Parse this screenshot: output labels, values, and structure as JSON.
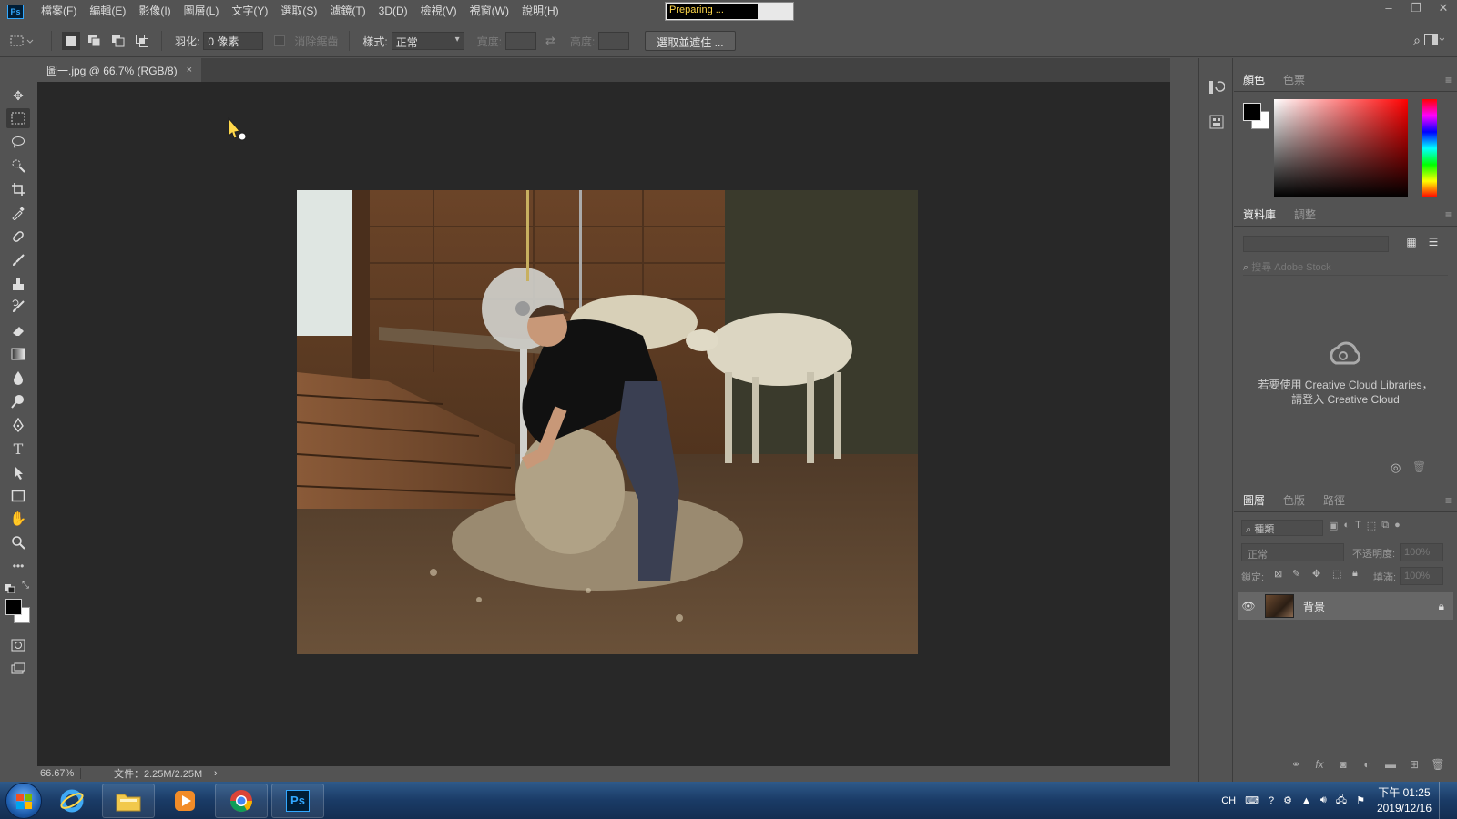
{
  "app": {
    "logo": "Ps",
    "progress_text": "Preparing ..."
  },
  "menu": [
    "檔案(F)",
    "編輯(E)",
    "影像(I)",
    "圖層(L)",
    "文字(Y)",
    "選取(S)",
    "濾鏡(T)",
    "3D(D)",
    "檢視(V)",
    "視窗(W)",
    "說明(H)"
  ],
  "window_controls": {
    "minimize": "–",
    "restore": "❐",
    "close": "✕"
  },
  "options": {
    "feather_label": "羽化:",
    "feather_value": "0 像素",
    "antialias_label": "消除鋸齒",
    "style_label": "樣式:",
    "style_value": "正常",
    "width_label": "寬度:",
    "height_label": "高度:",
    "select_mask_button": "選取並遮住 ..."
  },
  "document": {
    "tab_title": "圖一.jpg @ 66.7% (RGB/8)",
    "close": "×"
  },
  "status": {
    "zoom": "66.67%",
    "doc_info": "文件：2.25M/2.25M",
    "arrow": "›"
  },
  "panels": {
    "color": {
      "tabs": [
        "顏色",
        "色票"
      ]
    },
    "libraries": {
      "tabs": [
        "資料庫",
        "調整"
      ],
      "search_placeholder": "搜尋 Adobe Stock",
      "message_line1": "若要使用 Creative Cloud Libraries，",
      "message_line2": "請登入 Creative Cloud"
    },
    "layers": {
      "tabs": [
        "圖層",
        "色版",
        "路徑"
      ],
      "filter_label": "種類",
      "blend_mode": "正常",
      "opacity_label": "不透明度:",
      "opacity_value": "100%",
      "lock_label": "鎖定:",
      "fill_label": "填滿:",
      "fill_value": "100%",
      "layer_name": "背景"
    }
  },
  "taskbar": {
    "tray_lang": "CH",
    "clock_time": "下午 01:25",
    "clock_date": "2019/12/16"
  },
  "colors": {
    "ui_bg": "#535353",
    "canvas_bg": "#282828",
    "accent": "#31a8ff"
  }
}
